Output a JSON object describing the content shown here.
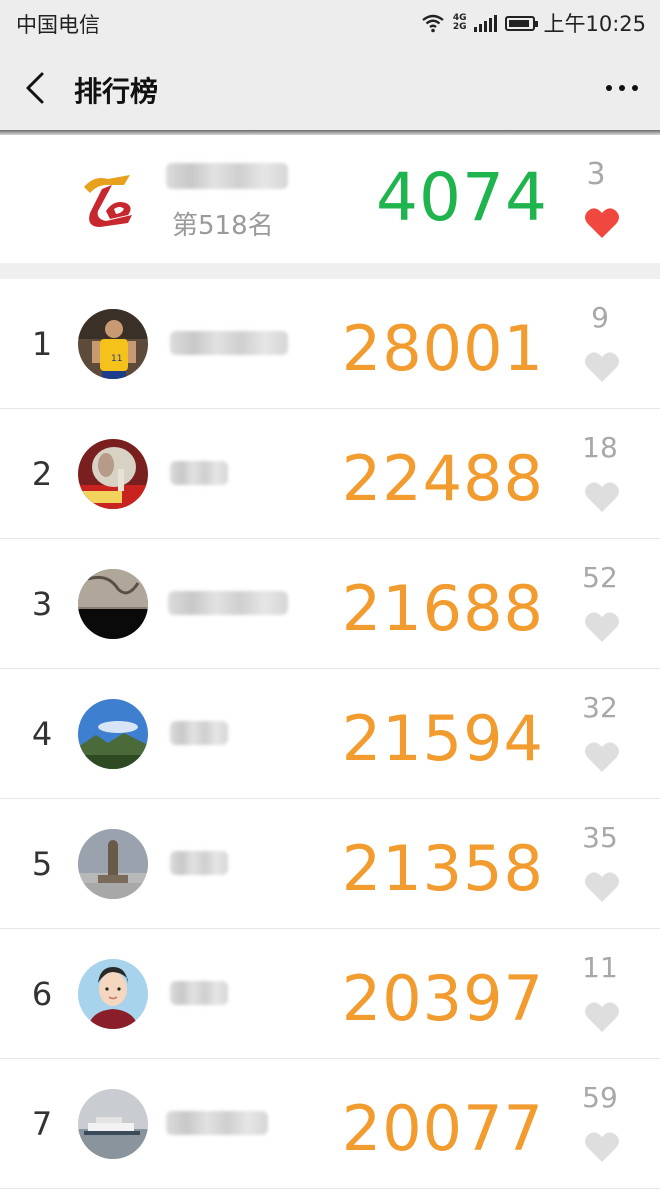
{
  "status_bar": {
    "carrier": "中国电信",
    "net_label_top": "4G",
    "net_label_bottom": "2G",
    "time": "上午10:25",
    "icons": [
      "wifi-icon",
      "signal-icon",
      "battery-icon"
    ]
  },
  "nav": {
    "title": "排行榜",
    "back_icon": "chevron-left-icon",
    "more_icon": "more-dots-icon"
  },
  "me": {
    "rank_text": "第518名",
    "steps": "4074",
    "likes": "3",
    "liked": true,
    "logo_icon": "app-logo"
  },
  "list": [
    {
      "rank": "1",
      "steps": "28001",
      "likes": "9"
    },
    {
      "rank": "2",
      "steps": "22488",
      "likes": "18"
    },
    {
      "rank": "3",
      "steps": "21688",
      "likes": "52"
    },
    {
      "rank": "4",
      "steps": "21594",
      "likes": "32"
    },
    {
      "rank": "5",
      "steps": "21358",
      "likes": "35"
    },
    {
      "rank": "6",
      "steps": "20397",
      "likes": "11"
    },
    {
      "rank": "7",
      "steps": "20077",
      "likes": "59"
    }
  ],
  "colors": {
    "my_steps": "#1fb44e",
    "list_steps": "#f29b2e",
    "heart_liked": "#f0473e",
    "heart_unliked": "#dedede"
  }
}
